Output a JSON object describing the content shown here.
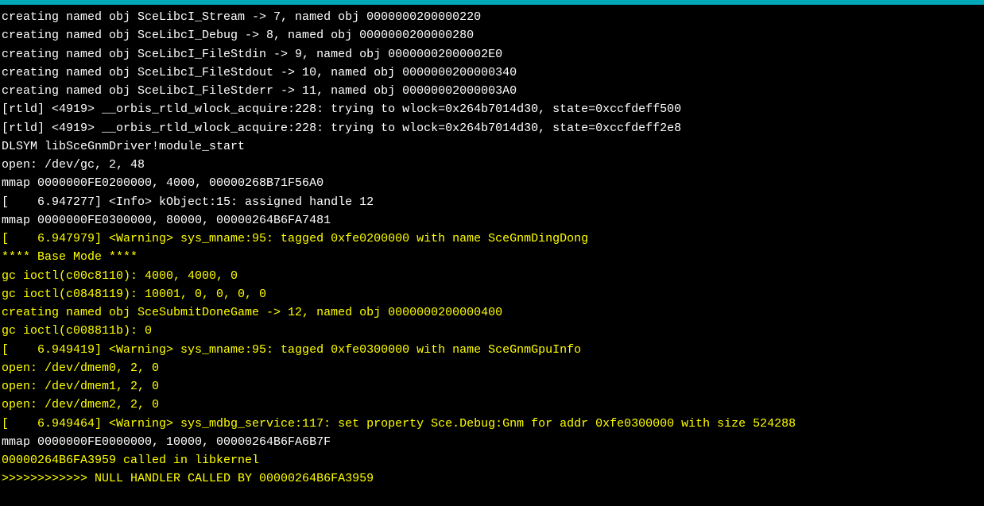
{
  "terminal": {
    "lines": [
      {
        "color": "white",
        "text": "creating named obj SceLibcI_Stream -> 7, named obj 0000000200000220"
      },
      {
        "color": "white",
        "text": "creating named obj SceLibcI_Debug -> 8, named obj 0000000200000280"
      },
      {
        "color": "white",
        "text": "creating named obj SceLibcI_FileStdin -> 9, named obj 00000002000002E0"
      },
      {
        "color": "white",
        "text": "creating named obj SceLibcI_FileStdout -> 10, named obj 0000000200000340"
      },
      {
        "color": "white",
        "text": "creating named obj SceLibcI_FileStderr -> 11, named obj 00000002000003A0"
      },
      {
        "color": "white",
        "text": "[rtld] <4919> __orbis_rtld_wlock_acquire:228: trying to wlock=0x264b7014d30, state=0xccfdeff500"
      },
      {
        "color": "white",
        "text": "[rtld] <4919> __orbis_rtld_wlock_acquire:228: trying to wlock=0x264b7014d30, state=0xccfdeff2e8"
      },
      {
        "color": "white",
        "text": "DLSYM libSceGnmDriver!module_start"
      },
      {
        "color": "white",
        "text": "open: /dev/gc, 2, 48"
      },
      {
        "color": "white",
        "text": "mmap 0000000FE0200000, 4000, 00000268B71F56A0"
      },
      {
        "color": "white",
        "text": "[    6.947277] <Info> kObject:15: assigned handle 12"
      },
      {
        "color": "white",
        "text": "mmap 0000000FE0300000, 80000, 00000264B6FA7481"
      },
      {
        "color": "yellow",
        "text": "[    6.947979] <Warning> sys_mname:95: tagged 0xfe0200000 with name SceGnmDingDong"
      },
      {
        "color": "yellow",
        "text": "**** Base Mode ****"
      },
      {
        "color": "yellow",
        "text": "gc ioctl(c00c8110): 4000, 4000, 0"
      },
      {
        "color": "yellow",
        "text": "gc ioctl(c0848119): 10001, 0, 0, 0, 0"
      },
      {
        "color": "yellow",
        "text": "creating named obj SceSubmitDoneGame -> 12, named obj 0000000200000400"
      },
      {
        "color": "yellow",
        "text": "gc ioctl(c008811b): 0"
      },
      {
        "color": "yellow",
        "text": "[    6.949419] <Warning> sys_mname:95: tagged 0xfe0300000 with name SceGnmGpuInfo"
      },
      {
        "color": "yellow",
        "text": "open: /dev/dmem0, 2, 0"
      },
      {
        "color": "yellow",
        "text": "open: /dev/dmem1, 2, 0"
      },
      {
        "color": "yellow",
        "text": "open: /dev/dmem2, 2, 0"
      },
      {
        "color": "yellow",
        "text": "[    6.949464] <Warning> sys_mdbg_service:117: set property Sce.Debug:Gnm for addr 0xfe0300000 with size 524288"
      },
      {
        "color": "white",
        "text": "mmap 0000000FE0000000, 10000, 00000264B6FA6B7F"
      },
      {
        "color": "yellow",
        "text": "00000264B6FA3959 called in libkernel"
      },
      {
        "color": "yellow",
        "text": ">>>>>>>>>>>> NULL HANDLER CALLED BY 00000264B6FA3959"
      }
    ]
  }
}
